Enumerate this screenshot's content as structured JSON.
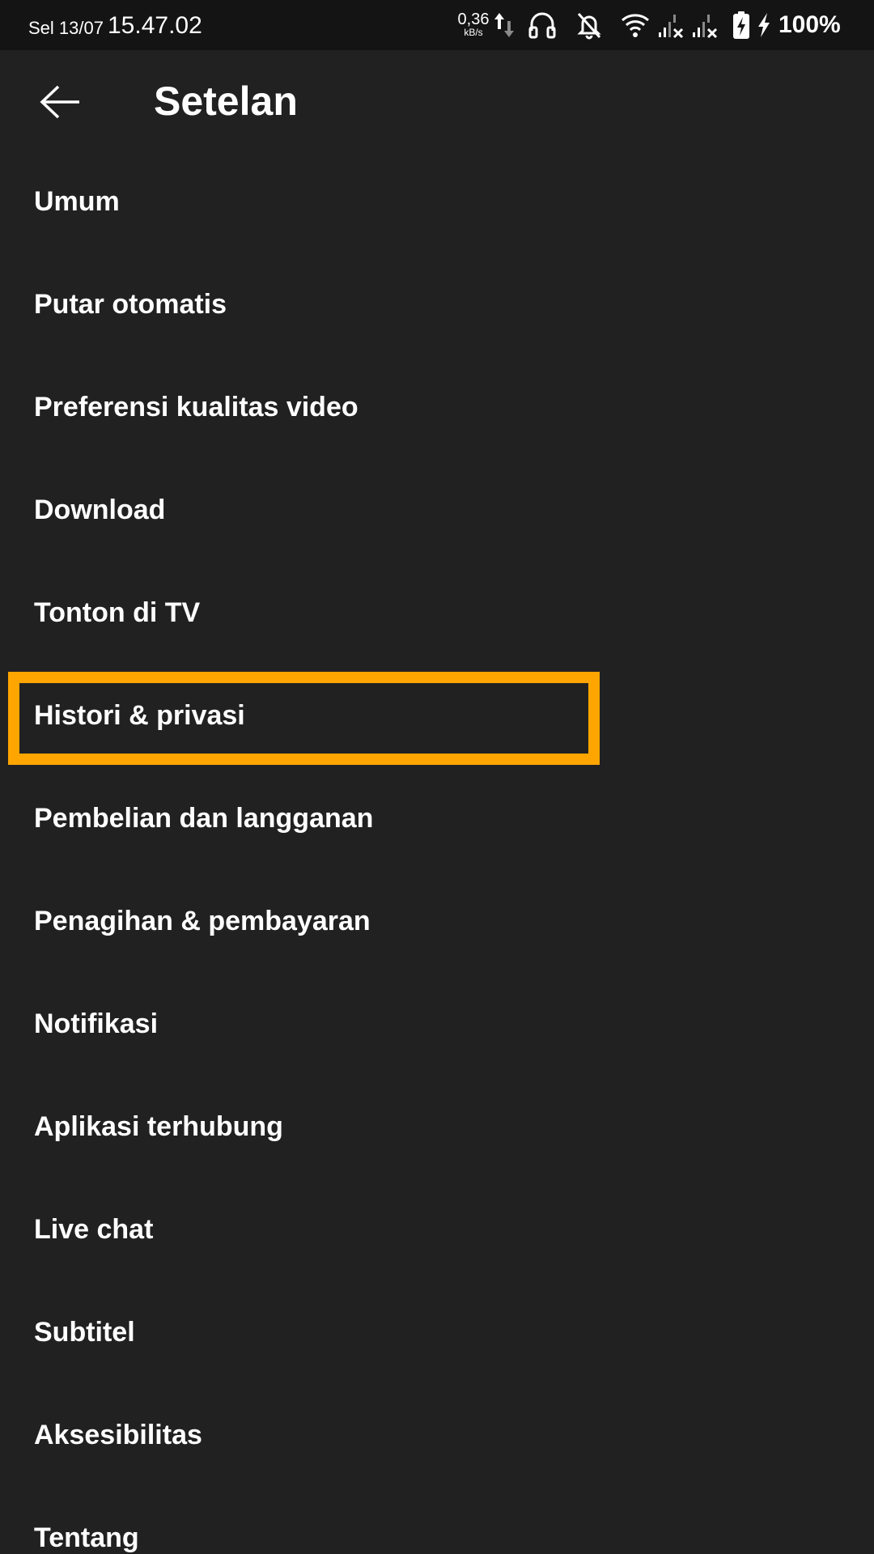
{
  "status_bar": {
    "date": "Sel 13/07",
    "time": "15.47.02",
    "speed_value": "0,36",
    "speed_unit": "kB/s",
    "battery": "100%",
    "icons": [
      "data-transfer-icon",
      "headphones-icon",
      "notifications-off-icon",
      "wifi-icon",
      "signal-no-service-icon",
      "signal-no-service-icon",
      "battery-charging-icon",
      "charging-bolt-icon"
    ]
  },
  "header": {
    "title": "Setelan",
    "back_icon": "arrow-left-icon"
  },
  "menu": {
    "items": [
      {
        "label": "Umum"
      },
      {
        "label": "Putar otomatis"
      },
      {
        "label": "Preferensi kualitas video"
      },
      {
        "label": "Download"
      },
      {
        "label": "Tonton di TV"
      },
      {
        "label": "Histori & privasi"
      },
      {
        "label": "Pembelian dan langganan"
      },
      {
        "label": "Penagihan & pembayaran"
      },
      {
        "label": "Notifikasi"
      },
      {
        "label": "Aplikasi terhubung"
      },
      {
        "label": "Live chat"
      },
      {
        "label": "Subtitel"
      },
      {
        "label": "Aksesibilitas"
      },
      {
        "label": "Tentang"
      }
    ],
    "highlighted_index": 5
  },
  "colors": {
    "background": "#212121",
    "status_bar": "#141414",
    "highlight": "#ffa500",
    "text": "#ffffff"
  }
}
